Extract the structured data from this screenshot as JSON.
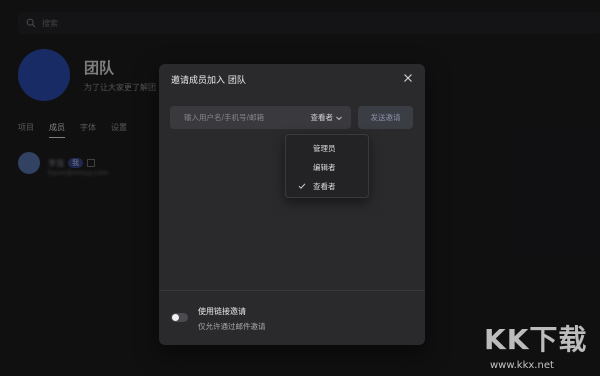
{
  "background": {
    "search_placeholder": "搜索",
    "team": {
      "name": "团队",
      "description": "为了让大家更了解团"
    },
    "tabs": [
      {
        "label": "项目",
        "active": false
      },
      {
        "label": "成员",
        "active": true
      },
      {
        "label": "字体",
        "active": false
      },
      {
        "label": "设置",
        "active": false
      }
    ],
    "member": {
      "name": "李强",
      "badge": "我",
      "email": "tiyun@vmay.com"
    }
  },
  "modal": {
    "title": "邀请成员加入 团队",
    "invite_placeholder": "输入用户名/手机号/邮箱",
    "selected_role": "查看者",
    "send_button": "发送邀请",
    "role_options": [
      {
        "label": "管理员",
        "selected": false
      },
      {
        "label": "编辑者",
        "selected": false
      },
      {
        "label": "查看者",
        "selected": true
      }
    ],
    "link_invite": {
      "title": "使用链接邀请",
      "description": "仅允许通过邮件邀请",
      "enabled": false
    }
  },
  "watermark": {
    "logo": "KK下载",
    "url": "www.kkx.net"
  },
  "colors": {
    "team_avatar": "#2f4fb8",
    "modal_bg": "#2a2a2d",
    "page_bg": "#1e1e20"
  },
  "icons": [
    "search-icon",
    "close-icon",
    "chevron-down-icon",
    "check-icon",
    "edit-icon"
  ]
}
